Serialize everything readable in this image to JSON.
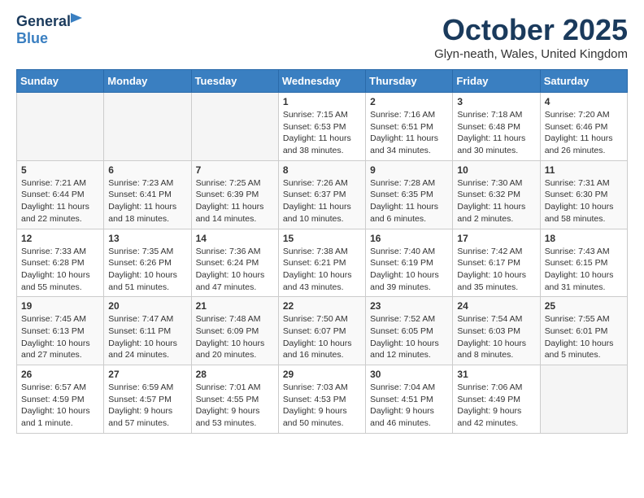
{
  "header": {
    "logo_general": "General",
    "logo_blue": "Blue",
    "month": "October 2025",
    "location": "Glyn-neath, Wales, United Kingdom"
  },
  "days_of_week": [
    "Sunday",
    "Monday",
    "Tuesday",
    "Wednesday",
    "Thursday",
    "Friday",
    "Saturday"
  ],
  "weeks": [
    [
      {
        "day": "",
        "info": ""
      },
      {
        "day": "",
        "info": ""
      },
      {
        "day": "",
        "info": ""
      },
      {
        "day": "1",
        "info": "Sunrise: 7:15 AM\nSunset: 6:53 PM\nDaylight: 11 hours\nand 38 minutes."
      },
      {
        "day": "2",
        "info": "Sunrise: 7:16 AM\nSunset: 6:51 PM\nDaylight: 11 hours\nand 34 minutes."
      },
      {
        "day": "3",
        "info": "Sunrise: 7:18 AM\nSunset: 6:48 PM\nDaylight: 11 hours\nand 30 minutes."
      },
      {
        "day": "4",
        "info": "Sunrise: 7:20 AM\nSunset: 6:46 PM\nDaylight: 11 hours\nand 26 minutes."
      }
    ],
    [
      {
        "day": "5",
        "info": "Sunrise: 7:21 AM\nSunset: 6:44 PM\nDaylight: 11 hours\nand 22 minutes."
      },
      {
        "day": "6",
        "info": "Sunrise: 7:23 AM\nSunset: 6:41 PM\nDaylight: 11 hours\nand 18 minutes."
      },
      {
        "day": "7",
        "info": "Sunrise: 7:25 AM\nSunset: 6:39 PM\nDaylight: 11 hours\nand 14 minutes."
      },
      {
        "day": "8",
        "info": "Sunrise: 7:26 AM\nSunset: 6:37 PM\nDaylight: 11 hours\nand 10 minutes."
      },
      {
        "day": "9",
        "info": "Sunrise: 7:28 AM\nSunset: 6:35 PM\nDaylight: 11 hours\nand 6 minutes."
      },
      {
        "day": "10",
        "info": "Sunrise: 7:30 AM\nSunset: 6:32 PM\nDaylight: 11 hours\nand 2 minutes."
      },
      {
        "day": "11",
        "info": "Sunrise: 7:31 AM\nSunset: 6:30 PM\nDaylight: 10 hours\nand 58 minutes."
      }
    ],
    [
      {
        "day": "12",
        "info": "Sunrise: 7:33 AM\nSunset: 6:28 PM\nDaylight: 10 hours\nand 55 minutes."
      },
      {
        "day": "13",
        "info": "Sunrise: 7:35 AM\nSunset: 6:26 PM\nDaylight: 10 hours\nand 51 minutes."
      },
      {
        "day": "14",
        "info": "Sunrise: 7:36 AM\nSunset: 6:24 PM\nDaylight: 10 hours\nand 47 minutes."
      },
      {
        "day": "15",
        "info": "Sunrise: 7:38 AM\nSunset: 6:21 PM\nDaylight: 10 hours\nand 43 minutes."
      },
      {
        "day": "16",
        "info": "Sunrise: 7:40 AM\nSunset: 6:19 PM\nDaylight: 10 hours\nand 39 minutes."
      },
      {
        "day": "17",
        "info": "Sunrise: 7:42 AM\nSunset: 6:17 PM\nDaylight: 10 hours\nand 35 minutes."
      },
      {
        "day": "18",
        "info": "Sunrise: 7:43 AM\nSunset: 6:15 PM\nDaylight: 10 hours\nand 31 minutes."
      }
    ],
    [
      {
        "day": "19",
        "info": "Sunrise: 7:45 AM\nSunset: 6:13 PM\nDaylight: 10 hours\nand 27 minutes."
      },
      {
        "day": "20",
        "info": "Sunrise: 7:47 AM\nSunset: 6:11 PM\nDaylight: 10 hours\nand 24 minutes."
      },
      {
        "day": "21",
        "info": "Sunrise: 7:48 AM\nSunset: 6:09 PM\nDaylight: 10 hours\nand 20 minutes."
      },
      {
        "day": "22",
        "info": "Sunrise: 7:50 AM\nSunset: 6:07 PM\nDaylight: 10 hours\nand 16 minutes."
      },
      {
        "day": "23",
        "info": "Sunrise: 7:52 AM\nSunset: 6:05 PM\nDaylight: 10 hours\nand 12 minutes."
      },
      {
        "day": "24",
        "info": "Sunrise: 7:54 AM\nSunset: 6:03 PM\nDaylight: 10 hours\nand 8 minutes."
      },
      {
        "day": "25",
        "info": "Sunrise: 7:55 AM\nSunset: 6:01 PM\nDaylight: 10 hours\nand 5 minutes."
      }
    ],
    [
      {
        "day": "26",
        "info": "Sunrise: 6:57 AM\nSunset: 4:59 PM\nDaylight: 10 hours\nand 1 minute."
      },
      {
        "day": "27",
        "info": "Sunrise: 6:59 AM\nSunset: 4:57 PM\nDaylight: 9 hours\nand 57 minutes."
      },
      {
        "day": "28",
        "info": "Sunrise: 7:01 AM\nSunset: 4:55 PM\nDaylight: 9 hours\nand 53 minutes."
      },
      {
        "day": "29",
        "info": "Sunrise: 7:03 AM\nSunset: 4:53 PM\nDaylight: 9 hours\nand 50 minutes."
      },
      {
        "day": "30",
        "info": "Sunrise: 7:04 AM\nSunset: 4:51 PM\nDaylight: 9 hours\nand 46 minutes."
      },
      {
        "day": "31",
        "info": "Sunrise: 7:06 AM\nSunset: 4:49 PM\nDaylight: 9 hours\nand 42 minutes."
      },
      {
        "day": "",
        "info": ""
      }
    ]
  ]
}
